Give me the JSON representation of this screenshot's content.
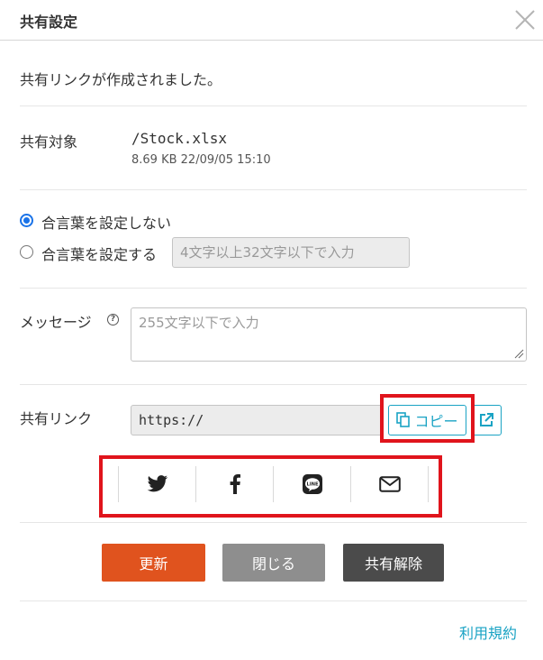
{
  "dialog": {
    "title": "共有設定",
    "created_message": "共有リンクが作成されました。"
  },
  "target": {
    "label": "共有対象",
    "filename": "/Stock.xlsx",
    "meta": "8.69 KB 22/09/05 15:10"
  },
  "password": {
    "option_none_label": "合言葉を設定しない",
    "option_set_label": "合言葉を設定する",
    "selected": "none",
    "input_placeholder": "4文字以上32文字以下で入力"
  },
  "message": {
    "label": "メッセージ",
    "help_glyph": "?",
    "placeholder": "255文字以下で入力"
  },
  "share_link": {
    "label": "共有リンク",
    "value": "https://",
    "copy_label": "コピー"
  },
  "social": {
    "icons": [
      "twitter-icon",
      "facebook-icon",
      "line-icon",
      "mail-icon"
    ],
    "line_text": "LINE"
  },
  "buttons": {
    "update": "更新",
    "close": "閉じる",
    "unshare": "共有解除"
  },
  "footer": {
    "terms_link": "利用規約"
  },
  "colors": {
    "accent": "#1aa3c4",
    "update_button": "#e0531e",
    "close_button": "#8e8e8e",
    "unshare_button": "#4b4b4b",
    "highlight_box": "#e0141c",
    "radio_selected": "#1a73e8"
  }
}
